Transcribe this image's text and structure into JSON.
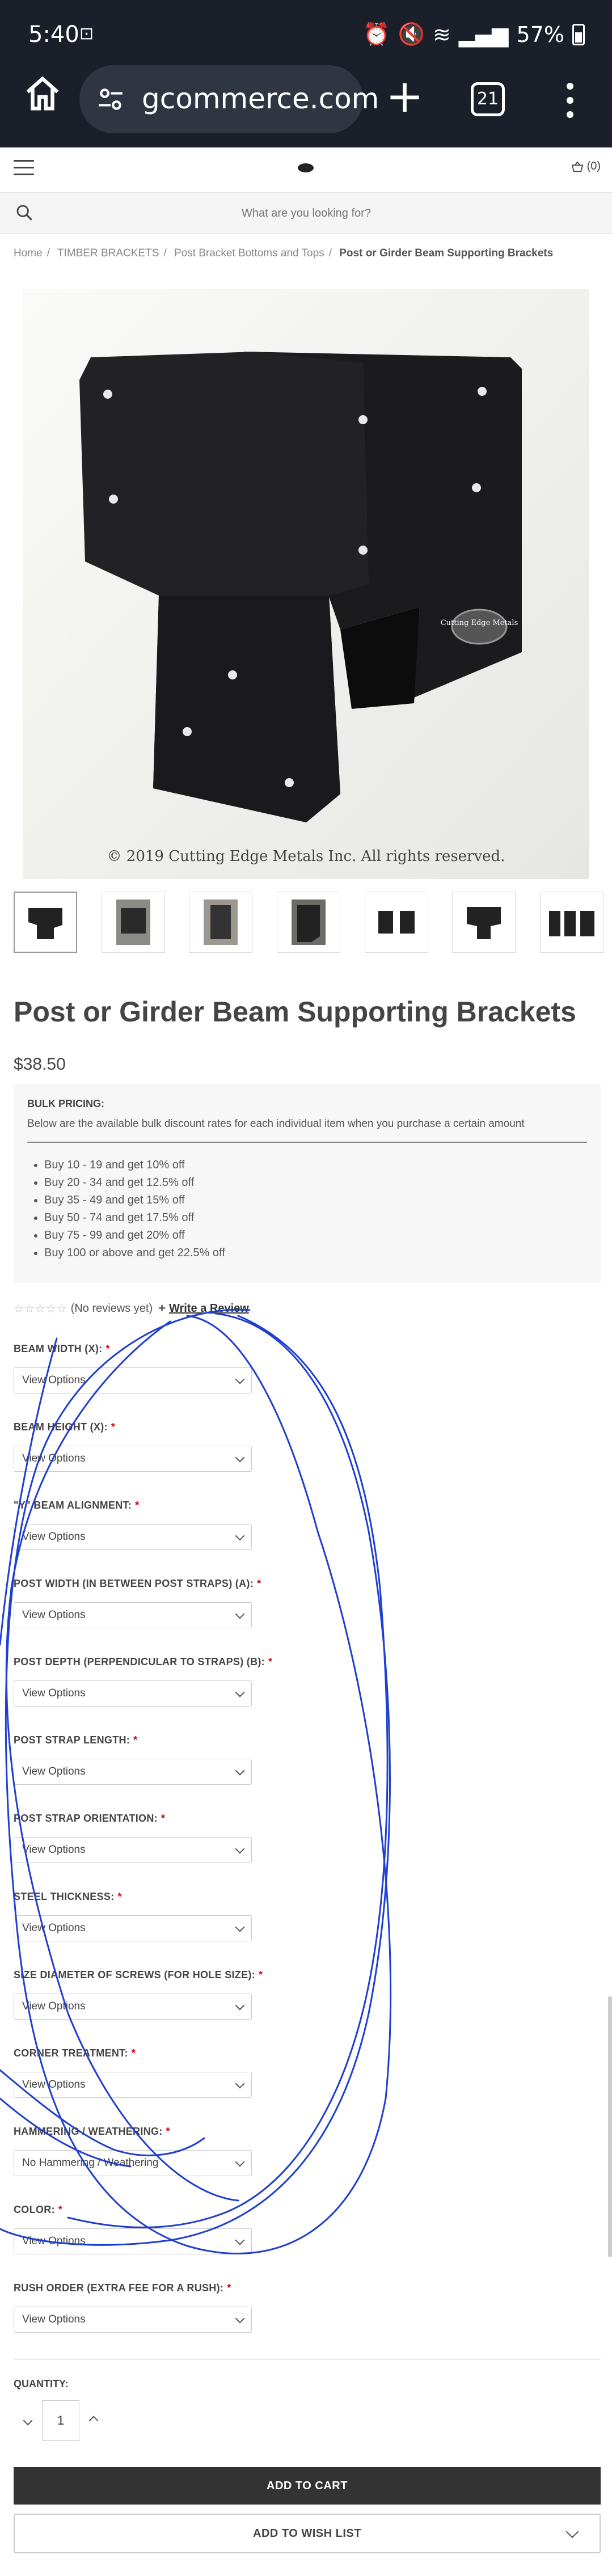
{
  "status_bar": {
    "time": "5:40",
    "battery": "57%"
  },
  "browser": {
    "url": "gcommerce.com",
    "tab_count": "21"
  },
  "header": {
    "cart_count": "(0)"
  },
  "search": {
    "placeholder": "What are you looking for?"
  },
  "breadcrumbs": [
    "Home",
    "TIMBER BRACKETS",
    "Post Bracket Bottoms and Tops",
    "Post or Girder Beam Supporting Brackets"
  ],
  "image": {
    "copyright": "© 2019 Cutting Edge Metals Inc. All rights reserved.",
    "watermark": "Cutting Edge Metals"
  },
  "product": {
    "title": "Post or Girder Beam Supporting Brackets",
    "price": "$38.50"
  },
  "bulk": {
    "title": "BULK PRICING:",
    "desc": "Below are the available bulk discount rates for each individual item when you purchase a certain amount",
    "items": [
      "Buy 10 - 19 and get 10% off",
      "Buy 20 - 34 and get 12.5% off",
      "Buy 35 - 49 and get 15% off",
      "Buy 50 - 74 and get 17.5% off",
      "Buy 75 - 99 and get 20% off",
      "Buy 100 or above and get 22.5% off"
    ]
  },
  "reviews": {
    "stars": "☆☆☆☆☆",
    "text": "(No reviews yet)",
    "write": "Write a Review"
  },
  "options": [
    {
      "label": "BEAM WIDTH (X):",
      "value": "View Options"
    },
    {
      "label": "BEAM HEIGHT (X):",
      "value": "View Options"
    },
    {
      "label": "\"Y\" BEAM ALIGNMENT:",
      "value": "View Options"
    },
    {
      "label": "POST WIDTH (IN BETWEEN POST STRAPS) (A):",
      "value": "View Options"
    },
    {
      "label": "POST DEPTH (PERPENDICULAR TO STRAPS) (B):",
      "value": "View Options"
    },
    {
      "label": "POST STRAP LENGTH:",
      "value": "View Options"
    },
    {
      "label": "POST STRAP ORIENTATION:",
      "value": "View Options"
    },
    {
      "label": "STEEL THICKNESS:",
      "value": "View Options"
    },
    {
      "label": "SIZE DIAMETER OF SCREWS (FOR HOLE SIZE):",
      "value": "View Options"
    },
    {
      "label": "CORNER TREATMENT:",
      "value": "View Options"
    },
    {
      "label": "HAMMERING / WEATHERING:",
      "value": "No Hammering / Weathering"
    },
    {
      "label": "COLOR:",
      "value": "View Options"
    },
    {
      "label": "RUSH ORDER (EXTRA FEE FOR A RUSH):",
      "value": "View Options"
    }
  ],
  "required_mark": "*",
  "quantity": {
    "label": "QUANTITY:",
    "value": "1"
  },
  "actions": {
    "add_to_cart": "ADD TO CART",
    "wishlist": "ADD TO WISH LIST"
  },
  "colors": {
    "status_bg": "#1a1f29",
    "ink_scribble": "#1f3fd1",
    "button": "#333333"
  }
}
